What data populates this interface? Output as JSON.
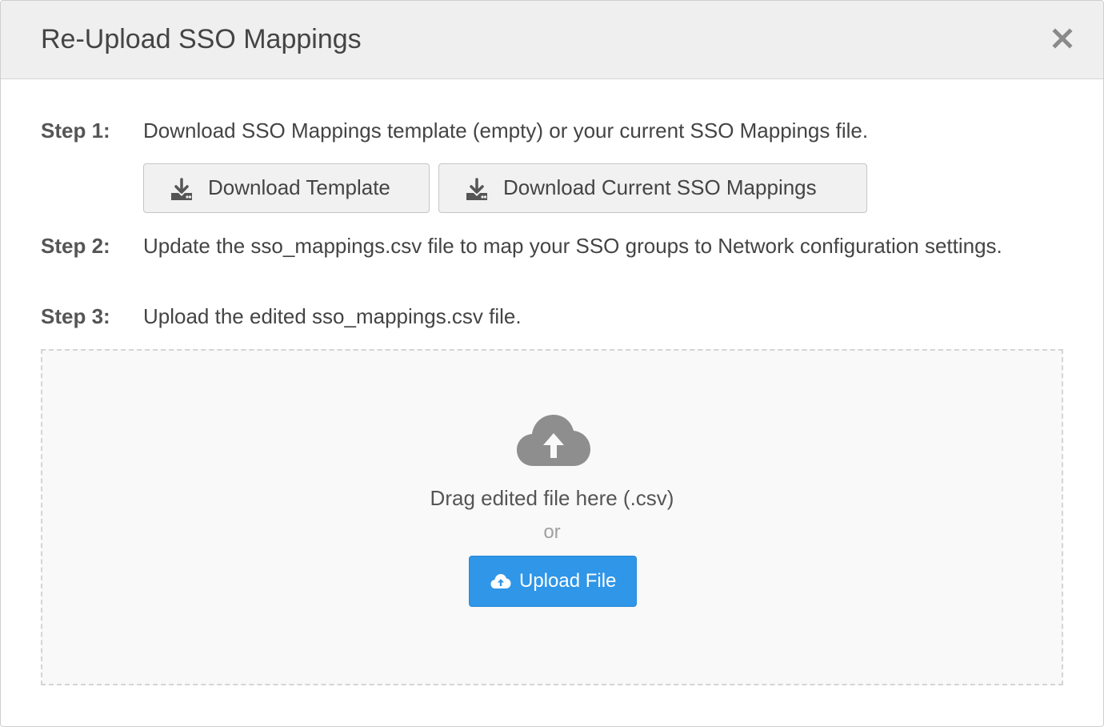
{
  "modal": {
    "title": "Re-Upload SSO Mappings",
    "close_label": "×"
  },
  "steps": [
    {
      "label": "Step 1:",
      "text": "Download SSO Mappings template (empty) or your current SSO Mappings file."
    },
    {
      "label": "Step 2:",
      "text": "Update the sso_mappings.csv file to map your SSO groups to Network configuration settings."
    },
    {
      "label": "Step 3:",
      "text": "Upload the edited sso_mappings.csv file."
    }
  ],
  "buttons": {
    "download_template": {
      "label": "Download Template",
      "icon": "download-icon"
    },
    "download_current": {
      "label": "Download Current SSO Mappings",
      "icon": "download-icon"
    }
  },
  "dropzone": {
    "icon": "cloud-upload-icon",
    "drag_text": "Drag edited file here (.csv)",
    "or_text": "or",
    "upload_button": {
      "label": "Upload File",
      "icon": "cloud-upload-icon"
    }
  },
  "colors": {
    "primary": "#2f96e8",
    "header_bg": "#efefef",
    "dropzone_bg": "#f9f9f9",
    "icon_gray": "#8e8e8e"
  }
}
